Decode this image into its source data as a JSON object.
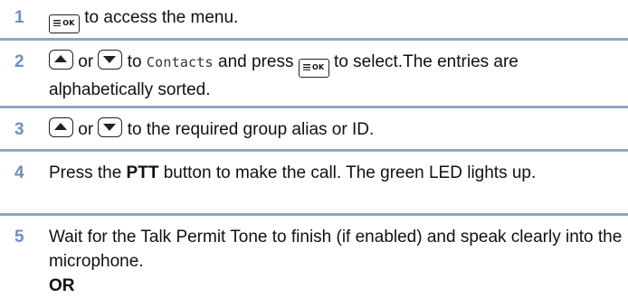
{
  "keys": {
    "menu_key": "OK",
    "up_key": "up-arrow-icon",
    "down_key": "down-arrow-icon"
  },
  "steps": [
    {
      "number": "1",
      "text_after_key": "to access the menu."
    },
    {
      "number": "2",
      "or": "or",
      "text_to": "to",
      "menu_item": "Contacts",
      "text_press": "and press",
      "text_end": "to select.The entries are alphabetically sorted."
    },
    {
      "number": "3",
      "or": "or",
      "text_end": "to the required group alias or ID."
    },
    {
      "number": "4",
      "text_before": "Press the",
      "bold": "PTT",
      "text_after": "button to make the call. The green LED lights up."
    },
    {
      "number": "5",
      "text": "Wait for the Talk Permit Tone to finish (if enabled) and speak clearly into the microphone.",
      "or_label": "OR"
    }
  ],
  "colors": {
    "step_number": "#6e8fbd",
    "rule": "#8fa6c8"
  }
}
